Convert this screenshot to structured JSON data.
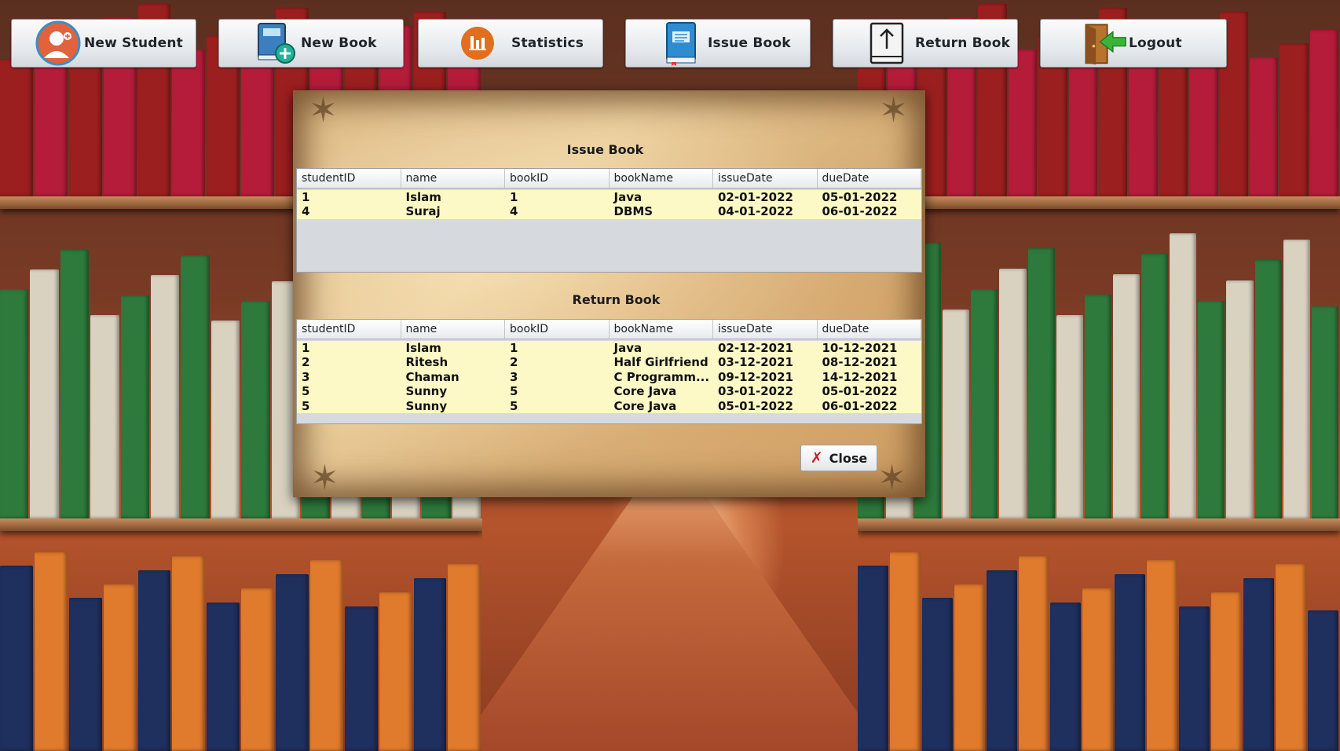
{
  "toolbar": {
    "buttons": [
      {
        "label": "New Student",
        "icon": "add-user-icon"
      },
      {
        "label": "New Book",
        "icon": "add-book-icon"
      },
      {
        "label": "Statistics",
        "icon": "statistics-icon"
      },
      {
        "label": "Issue Book",
        "icon": "issue-book-icon"
      },
      {
        "label": "Return Book",
        "icon": "return-book-icon"
      },
      {
        "label": "Logout",
        "icon": "logout-icon"
      }
    ]
  },
  "issue_section": {
    "title": "Issue Book",
    "columns": [
      "studentID",
      "name",
      "bookID",
      "bookName",
      "issueDate",
      "dueDate"
    ],
    "rows": [
      [
        "1",
        "Islam",
        "1",
        "Java",
        "02-01-2022",
        "05-01-2022"
      ],
      [
        "4",
        "Suraj",
        "4",
        "DBMS",
        "04-01-2022",
        "06-01-2022"
      ]
    ]
  },
  "return_section": {
    "title": "Return Book",
    "columns": [
      "studentID",
      "name",
      "bookID",
      "bookName",
      "issueDate",
      "dueDate"
    ],
    "rows": [
      [
        "1",
        "Islam",
        "1",
        "Java",
        "02-12-2021",
        "10-12-2021"
      ],
      [
        "2",
        "Ritesh",
        "2",
        "Half Girlfriend",
        "03-12-2021",
        "08-12-2021"
      ],
      [
        "3",
        "Chaman",
        "3",
        "C Programm...",
        "09-12-2021",
        "14-12-2021"
      ],
      [
        "5",
        "Sunny",
        "5",
        "Core Java",
        "03-01-2022",
        "05-01-2022"
      ],
      [
        "5",
        "Sunny",
        "5",
        "Core Java",
        "05-01-2022",
        "06-01-2022"
      ]
    ]
  },
  "close_label": "Close",
  "colors": {
    "row_bg": "#fdf9c6",
    "empty_table_bg": "#d6d9dd",
    "close_icon": "#d11a1a"
  }
}
